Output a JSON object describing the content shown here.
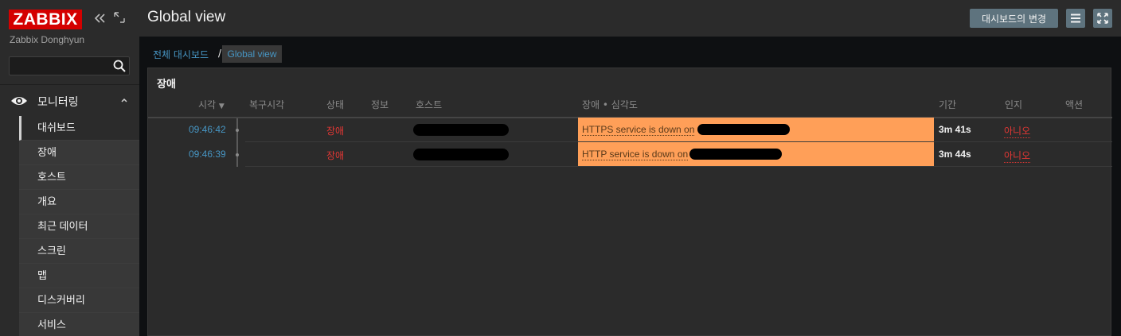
{
  "app": {
    "logo": "ZABBIX",
    "server_name": "Zabbix Donghyun"
  },
  "sidebar": {
    "search": {
      "value": "",
      "placeholder": ""
    },
    "section_label": "모니터링",
    "items": [
      {
        "label": "대쉬보드",
        "active": true
      },
      {
        "label": "장애"
      },
      {
        "label": "호스트"
      },
      {
        "label": "개요"
      },
      {
        "label": "최근 데이터"
      },
      {
        "label": "스크린"
      },
      {
        "label": "맵"
      },
      {
        "label": "디스커버리"
      },
      {
        "label": "서비스"
      }
    ]
  },
  "header": {
    "title": "Global view",
    "edit_button": "대시보드의 변경",
    "icons": [
      "menu-icon",
      "fullscreen-icon"
    ]
  },
  "breadcrumb": {
    "parent": "전체 대시보드",
    "separator": "/",
    "current": "Global view"
  },
  "widget": {
    "title": "장애",
    "columns": [
      "시각",
      "복구시각",
      "상태",
      "정보",
      "호스트",
      "장애 • 심각도",
      "기간",
      "인지",
      "액션"
    ],
    "sort_indicator": "▼",
    "rows": [
      {
        "time": "09:46:42",
        "recovery": "",
        "status": "장애",
        "info": "",
        "host": "",
        "problem": "HTTPS service is down on",
        "duration": "3m 41s",
        "ack": "아니오",
        "actions": ""
      },
      {
        "time": "09:46:39",
        "recovery": "",
        "status": "장애",
        "info": "",
        "host": "",
        "problem": "HTTP service is down on",
        "duration": "3m 44s",
        "ack": "아니오",
        "actions": ""
      }
    ]
  },
  "colors": {
    "accent_link": "#4796c4",
    "problem_status": "#e33734",
    "severity_average": "#ff9f58",
    "logo_red": "#d40000",
    "button": "#5e737e"
  }
}
